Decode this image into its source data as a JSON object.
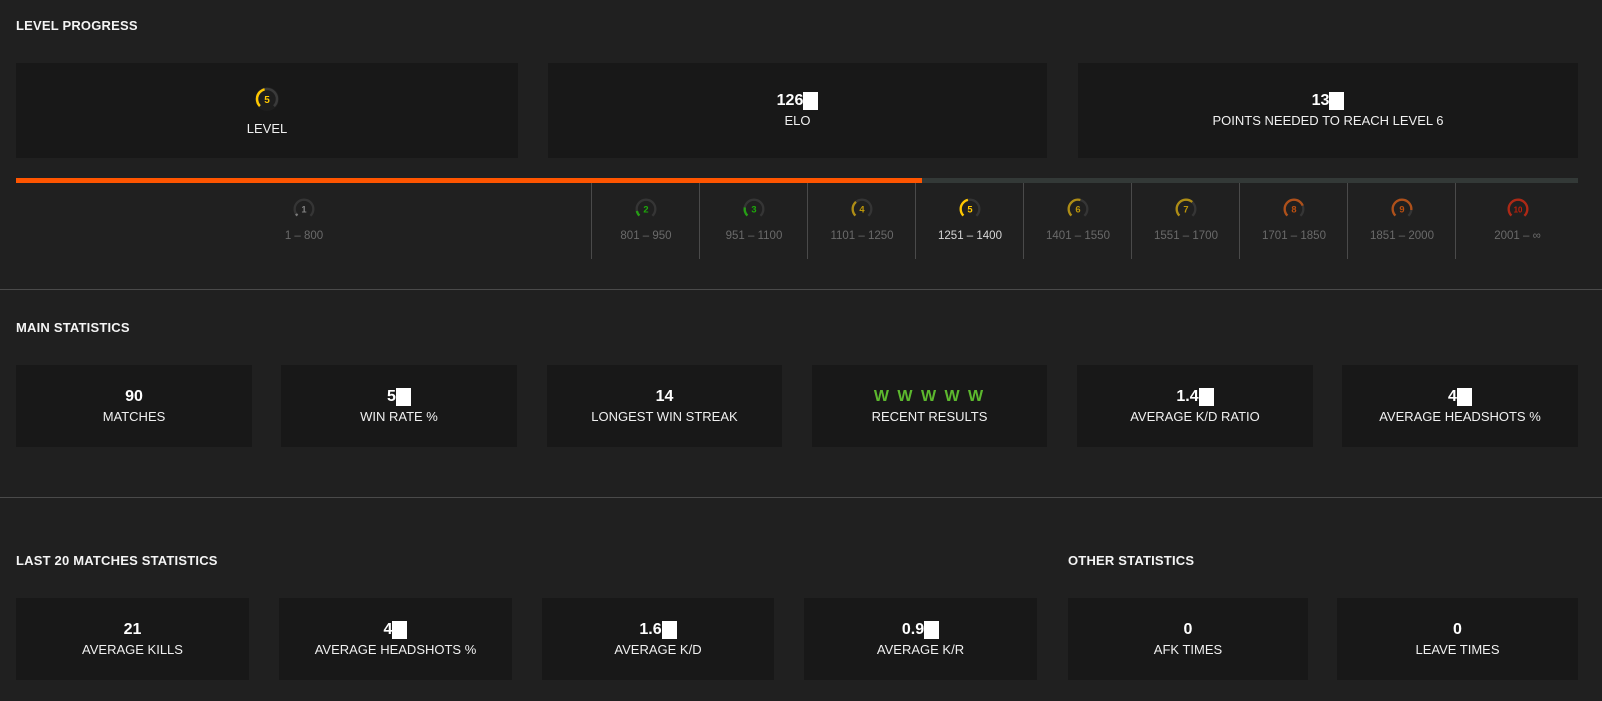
{
  "level_progress": {
    "title": "LEVEL PROGRESS",
    "level_card": {
      "value": "5",
      "label": "LEVEL",
      "color": "#ffc800"
    },
    "elo_card": {
      "value": "126",
      "label": "ELO",
      "masked": true
    },
    "points_card": {
      "value": "13",
      "label": "POINTS NEEDED TO REACH LEVEL 6",
      "masked": true
    },
    "progress": {
      "fill_fraction": 0.58,
      "fill_color": "#ff5500",
      "track_color": "#333937"
    },
    "levels": [
      {
        "level": "1",
        "range": "1 – 800",
        "color": "#aaaaaa",
        "arc": 0.05
      },
      {
        "level": "2",
        "range": "801 – 950",
        "color": "#1ce400",
        "arc": 0.12
      },
      {
        "level": "3",
        "range": "951 – 1100",
        "color": "#1ce400",
        "arc": 0.2
      },
      {
        "level": "4",
        "range": "1101 – 1250",
        "color": "#ffc800",
        "arc": 0.35
      },
      {
        "level": "5",
        "range": "1251 – 1400",
        "color": "#ffc800",
        "arc": 0.45,
        "current": true
      },
      {
        "level": "6",
        "range": "1401 – 1550",
        "color": "#ffc800",
        "arc": 0.55
      },
      {
        "level": "7",
        "range": "1551 – 1700",
        "color": "#ffc800",
        "arc": 0.65
      },
      {
        "level": "8",
        "range": "1701 – 1850",
        "color": "#ff6309",
        "arc": 0.75
      },
      {
        "level": "9",
        "range": "1851 – 2000",
        "color": "#ff6309",
        "arc": 0.85
      },
      {
        "level": "10",
        "range": "2001 – ∞",
        "color": "#fe1f00",
        "arc": 1.0
      }
    ]
  },
  "main_statistics": {
    "title": "MAIN STATISTICS",
    "cards": [
      {
        "value": "90",
        "label": "MATCHES"
      },
      {
        "value": "5",
        "label": "WIN RATE %",
        "masked": true
      },
      {
        "value": "14",
        "label": "LONGEST WIN STREAK"
      },
      {
        "value": "W W W W W",
        "label": "RECENT RESULTS",
        "color": "#5cb82e"
      },
      {
        "value": "1.4",
        "label": "AVERAGE K/D RATIO",
        "masked": true
      },
      {
        "value": "4",
        "label": "AVERAGE HEADSHOTS %",
        "masked": true
      }
    ]
  },
  "last20_statistics": {
    "title": "LAST 20 MATCHES STATISTICS",
    "cards": [
      {
        "value": "21",
        "label": "AVERAGE KILLS"
      },
      {
        "value": "4",
        "label": "AVERAGE HEADSHOTS %",
        "masked": true
      },
      {
        "value": "1.6",
        "label": "AVERAGE K/D",
        "masked": true
      },
      {
        "value": "0.9",
        "label": "AVERAGE K/R",
        "masked": true
      }
    ]
  },
  "other_statistics": {
    "title": "OTHER STATISTICS",
    "cards": [
      {
        "value": "0",
        "label": "AFK TIMES"
      },
      {
        "value": "0",
        "label": "LEAVE TIMES"
      }
    ]
  }
}
